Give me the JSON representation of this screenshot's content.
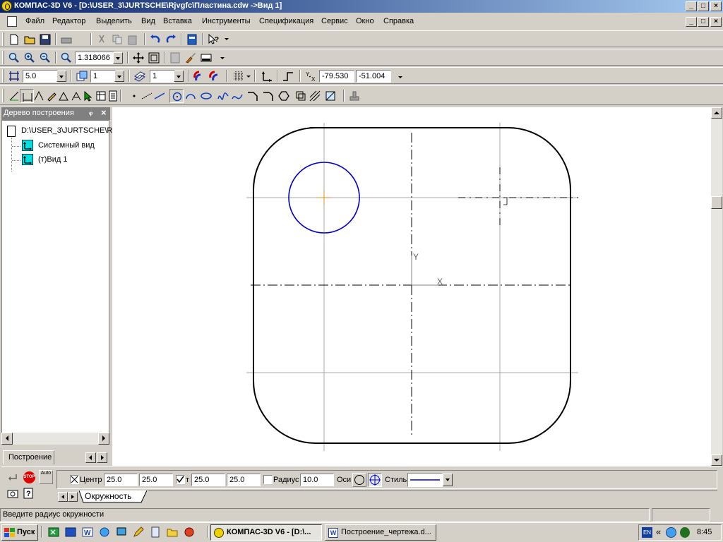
{
  "window": {
    "title": "КОМПАС-3D V6 - [D:\\USER_3\\JURTSCHE\\Rjvgfc\\Пластина.cdw ->Вид 1]",
    "controls": [
      "_",
      "□",
      "×"
    ]
  },
  "menu": [
    "Файл",
    "Редактор",
    "Выделить",
    "Вид",
    "Вставка",
    "Инструменты",
    "Спецификация",
    "Сервис",
    "Окно",
    "Справка"
  ],
  "view_toolbar": {
    "zoom_value": "1.318066"
  },
  "props_toolbar": {
    "step_value": "5.0",
    "layer_value": "1",
    "style_value": "1",
    "coord_x": "-79.530",
    "coord_y": "-51.004"
  },
  "tree": {
    "title": "Дерево построения",
    "pin": "ᵩ",
    "close": "×",
    "root": "D:\\USER_3\\JURTSCHE\\R:",
    "items": [
      "Системный вид",
      "(т)Вид 1"
    ],
    "tab": "Построение"
  },
  "command_panel": {
    "center_label": "Центр",
    "center_x": "25.0",
    "center_y": "25.0",
    "point_label": "т",
    "point_x": "25.0",
    "point_y": "25.0",
    "radius_label": "Радиус",
    "radius_value": "10.0",
    "axes_label": "Оси",
    "style_label": "Стиль",
    "tab_label": "Окружность",
    "auto_label": "Auto",
    "stop_label": "STOP"
  },
  "status": {
    "hint": "Введите радиус окружности"
  },
  "taskbar": {
    "start_label": "Пуск",
    "tasks": [
      "КОМПАС-3D V6 - [D:\\...",
      "Построение_чертежа.d..."
    ],
    "lang": "EN",
    "time": "8:45"
  },
  "drawing": {
    "axis_x_label": "X",
    "axis_y_label": "Y",
    "circle_color": "#0000cc",
    "contour_color": "#000000",
    "aux_color": "#a0a0a0"
  },
  "colors": {
    "title_start": "#0a246a",
    "title_end": "#a6caf0",
    "panel": "#d4d0c8"
  }
}
